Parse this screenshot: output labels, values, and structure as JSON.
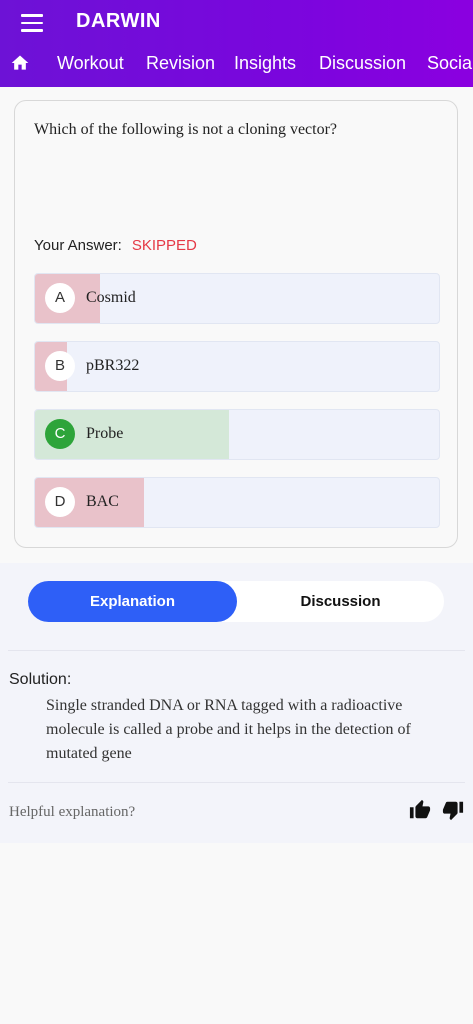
{
  "app": {
    "title": "DARWIN",
    "menu_icon": "menu-icon"
  },
  "nav": {
    "home_icon": "home-icon",
    "tabs": [
      "Workout",
      "Revision",
      "Insights",
      "Discussion",
      "Social"
    ]
  },
  "question": {
    "text": "Which of the following is not a cloning vector?",
    "your_answer_label": "Your Answer:",
    "your_answer_status": "SKIPPED",
    "options": [
      {
        "letter": "A",
        "text": "Cosmid",
        "fill_percent": 16,
        "correct": false
      },
      {
        "letter": "B",
        "text": "pBR322",
        "fill_percent": 8,
        "correct": false
      },
      {
        "letter": "C",
        "text": "Probe",
        "fill_percent": 48,
        "correct": true
      },
      {
        "letter": "D",
        "text": "BAC",
        "fill_percent": 27,
        "correct": false
      }
    ]
  },
  "tabs": {
    "explanation": "Explanation",
    "discussion": "Discussion",
    "active": "explanation"
  },
  "solution": {
    "title": "Solution:",
    "body": "Single stranded DNA or RNA tagged with a radioactive molecule is called a probe and it helps in the detection of mutated gene"
  },
  "feedback": {
    "prompt": "Helpful explanation?",
    "up_icon": "thumbs-up-icon",
    "down_icon": "thumbs-down-icon"
  },
  "colors": {
    "appbar": "#7a06dd",
    "skipped": "#e53946",
    "wrong_fill": "#e9c2ca",
    "correct_fill": "#d4e8d8",
    "correct_badge": "#2ea43a",
    "active_tab": "#2e5ff7"
  }
}
